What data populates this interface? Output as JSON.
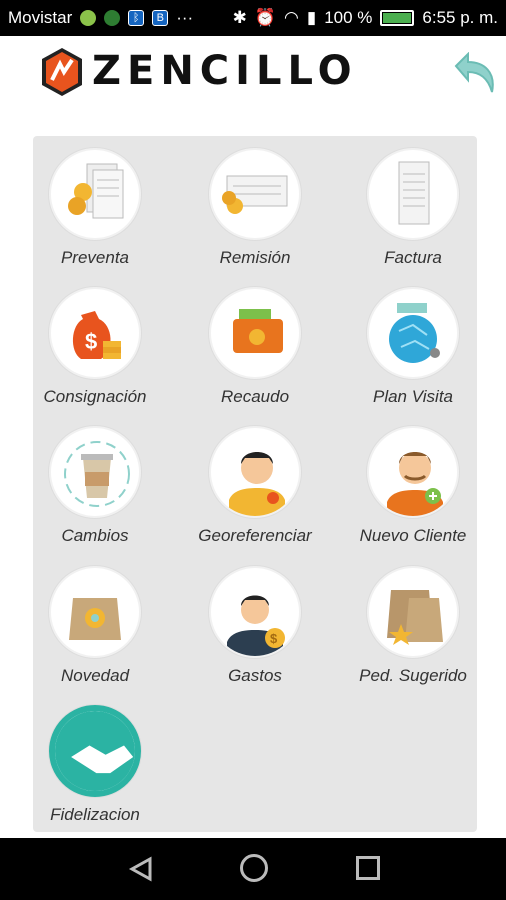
{
  "status_bar": {
    "carrier": "Movistar",
    "more": "···",
    "battery": "100 %",
    "time": "6:55 p. m."
  },
  "header": {
    "brand": "ZENCILLO",
    "back_icon": "undo-arrow-icon"
  },
  "menu": [
    {
      "label": "Preventa",
      "icon": "preventa-icon"
    },
    {
      "label": "Remisión",
      "icon": "remision-icon"
    },
    {
      "label": "Factura",
      "icon": "factura-icon"
    },
    {
      "label": "Consignación",
      "icon": "money-bag-icon"
    },
    {
      "label": "Recaudo",
      "icon": "wallet-icon"
    },
    {
      "label": "Plan Visita",
      "icon": "globe-icon"
    },
    {
      "label": "Cambios",
      "icon": "exchange-cup-icon"
    },
    {
      "label": "Georeferenciar",
      "icon": "georeference-person-icon"
    },
    {
      "label": "Nuevo Cliente",
      "icon": "new-client-icon"
    },
    {
      "label": "Novedad",
      "icon": "bulb-bag-icon"
    },
    {
      "label": "Gastos",
      "icon": "expenses-person-icon"
    },
    {
      "label": "Ped. Sugerido",
      "icon": "suggested-order-icon"
    },
    {
      "label": "Fidelizacion",
      "icon": "handshake-icon"
    }
  ],
  "colors": {
    "panel": "#e6e6e6",
    "accent": "#2bb3a3",
    "coin": "#f2b632"
  }
}
